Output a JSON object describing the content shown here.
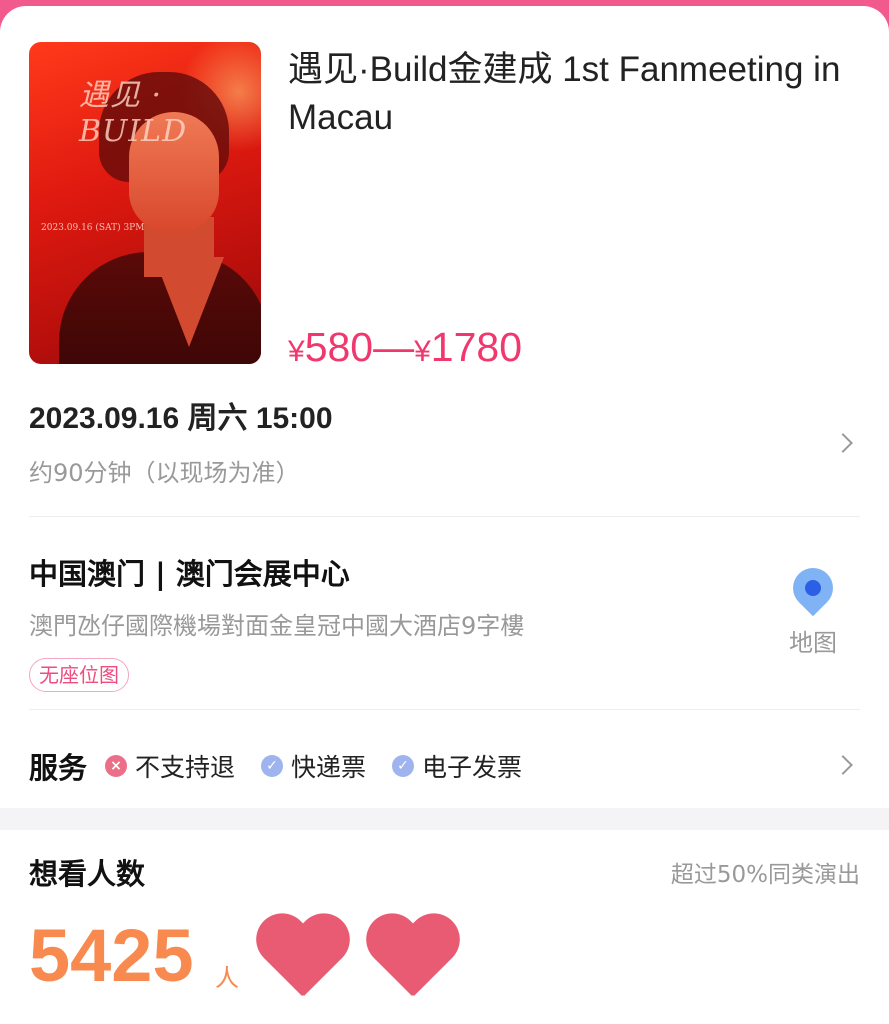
{
  "event": {
    "title": "遇见·Build金建成 1st Fanmeeting in Macau",
    "price": {
      "currency": "¥",
      "min": "580",
      "separator": "—",
      "max": "1780"
    },
    "poster": {
      "title_art": "遇见 · BUILD",
      "date_art": "2023.09.16 (SAT) 3PM"
    }
  },
  "schedule": {
    "datetime": "2023.09.16 周六 15:00",
    "duration": "约90分钟（以现场为准）"
  },
  "venue": {
    "name": "中国澳门 | 澳门会展中心",
    "address": "澳門氹仔國際機場對面金皇冠中國大酒店9字樓",
    "seat_tag": "无座位图",
    "map_label": "地图"
  },
  "services": {
    "title": "服务",
    "items": [
      {
        "label": "不支持退",
        "status": "no",
        "icon": "x-icon"
      },
      {
        "label": "快递票",
        "status": "ok",
        "icon": "check-icon"
      },
      {
        "label": "电子发票",
        "status": "ok",
        "icon": "check-icon"
      }
    ]
  },
  "interest": {
    "title": "想看人数",
    "compare": "超过50%同类演出",
    "count": "5425",
    "unit": "人"
  },
  "colors": {
    "accent_pink": "#f0386e",
    "count_orange": "#f8894f",
    "header_pink": "#f25a8e",
    "map_blue": "#2b5fe6"
  }
}
